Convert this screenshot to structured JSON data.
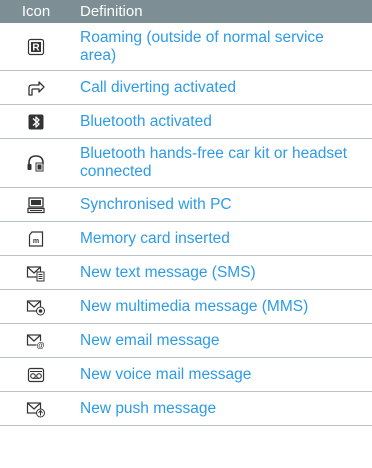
{
  "header": {
    "icon_col": "Icon",
    "definition_col": "Definition"
  },
  "rows": [
    {
      "icon": "roaming-icon",
      "definition": "Roaming (outside of normal service area)"
    },
    {
      "icon": "call-divert-icon",
      "definition": "Call diverting activated"
    },
    {
      "icon": "bluetooth-icon",
      "definition": "Bluetooth activated"
    },
    {
      "icon": "handsfree-headset-icon",
      "definition": "Bluetooth hands-free car kit or headset connected"
    },
    {
      "icon": "pc-sync-icon",
      "definition": "Synchronised with PC"
    },
    {
      "icon": "memory-card-icon",
      "definition": "Memory card inserted"
    },
    {
      "icon": "sms-icon",
      "definition": "New text message (SMS)"
    },
    {
      "icon": "mms-icon",
      "definition": "New multimedia message (MMS)"
    },
    {
      "icon": "email-icon",
      "definition": "New email message"
    },
    {
      "icon": "voicemail-icon",
      "definition": "New voice mail message"
    },
    {
      "icon": "push-message-icon",
      "definition": "New push message"
    }
  ],
  "colors": {
    "header_bg": "#7d8e95",
    "definition_text": "#2d9be6",
    "divider": "#b9c3c7"
  }
}
